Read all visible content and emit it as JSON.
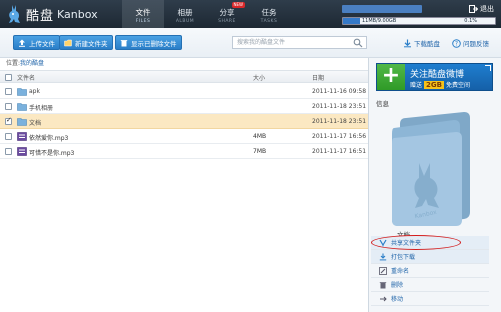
{
  "header": {
    "logo_cn": "酷盘",
    "logo_en": "Kanbox",
    "nav": [
      {
        "cn": "文件",
        "en": "FILES",
        "active": true
      },
      {
        "cn": "相册",
        "en": "ALBUM",
        "active": false
      },
      {
        "cn": "分享",
        "en": "SHARE",
        "active": false,
        "badge": "NEW"
      },
      {
        "cn": "任务",
        "en": "TASKS",
        "active": false
      }
    ],
    "exit_label": "退出",
    "quota": {
      "used_text": "11MB/9.00GB",
      "percent_text": "0.1%",
      "fraction": 0.001
    }
  },
  "toolbar": {
    "upload": "上传文件",
    "new_folder": "新建文件夹",
    "show_deleted": "显示已删除文件",
    "search_placeholder": "搜索我的酷盘文件",
    "download_client": "下载酷盘",
    "help": "问题反馈"
  },
  "breadcrumb": {
    "prefix": "位置:",
    "current": "我的酷盘"
  },
  "table": {
    "headers": {
      "name": "文件名",
      "size": "大小",
      "date": "日期"
    },
    "rows": [
      {
        "type": "folder",
        "name": "apk",
        "size": "",
        "date": "2011-11-16 09:58",
        "checked": false,
        "selected": false
      },
      {
        "type": "folder",
        "name": "手机相册",
        "size": "",
        "date": "2011-11-18 23:51",
        "checked": false,
        "selected": false
      },
      {
        "type": "folder",
        "name": "文档",
        "size": "",
        "date": "2011-11-18 23:51",
        "checked": true,
        "selected": true
      },
      {
        "type": "audio",
        "name": "依然爱你.mp3",
        "size": "4MB",
        "date": "2011-11-17 16:56",
        "checked": false,
        "selected": false
      },
      {
        "type": "audio",
        "name": "可惜不是你.mp3",
        "size": "7MB",
        "date": "2011-11-17 16:51",
        "checked": false,
        "selected": false
      }
    ]
  },
  "panel": {
    "weibo_line1": "关注酷盘微博",
    "weibo_line2_pre": "赠送",
    "weibo_gb": "2GB",
    "weibo_line2_post": "免费空间",
    "info_label": "信息",
    "selected_name": "文档",
    "actions": [
      {
        "label": "共享文件夹",
        "icon": "share-folder-icon",
        "highlight": true
      },
      {
        "label": "打包下载",
        "icon": "download-icon",
        "highlight": true
      },
      {
        "label": "重命名",
        "icon": "rename-icon",
        "highlight": false
      },
      {
        "label": "删除",
        "icon": "delete-icon",
        "highlight": false
      },
      {
        "label": "移动",
        "icon": "move-icon",
        "highlight": false
      }
    ]
  },
  "colors": {
    "accent": "#2a7ec8",
    "header": "#243140",
    "selected_row": "#fbe8c2",
    "annotation": "#d31d1d"
  }
}
